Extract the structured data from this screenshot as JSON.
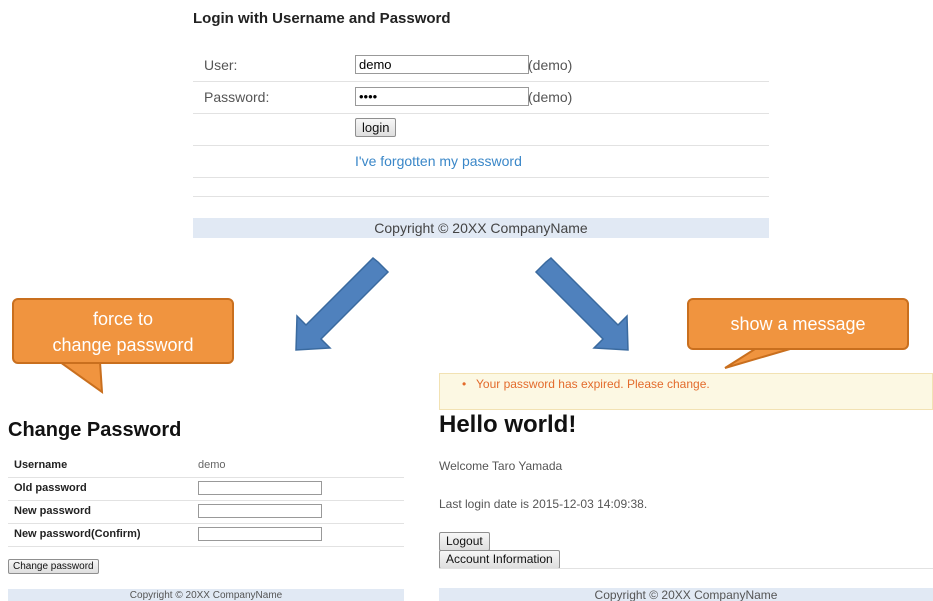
{
  "login": {
    "title": "Login with Username and Password",
    "user_label": "User:",
    "user_value": "demo",
    "user_hint": "(demo)",
    "password_label": "Password:",
    "password_value": "demo",
    "password_hint": "(demo)",
    "login_button": "login",
    "forgot_link": "I've forgotten my password",
    "footer": "Copyright © 20XX CompanyName"
  },
  "callouts": {
    "left_line1": "force to",
    "left_line2": "change password",
    "right": "show a message",
    "fill_color": "#f0943f"
  },
  "change_password": {
    "title": "Change Password",
    "username_label": "Username",
    "username_value": "demo",
    "old_password_label": "Old password",
    "new_password_label": "New password",
    "confirm_label": "New password(Confirm)",
    "submit_button": "Change password",
    "footer": "Copyright © 20XX CompanyName"
  },
  "home": {
    "message_bullet": "•",
    "message": "Your password has expired. Please change.",
    "title": "Hello world!",
    "welcome": "Welcome Taro Yamada",
    "last_login": "Last login date is 2015-12-03 14:09:38.",
    "logout_button": "Logout",
    "account_button": "Account Information",
    "footer": "Copyright © 20XX CompanyName"
  },
  "colors": {
    "arrow": "#4f81bd",
    "footer_bg": "#e1e9f4",
    "link": "#3a87c8",
    "warning_text": "#e36b2c"
  }
}
